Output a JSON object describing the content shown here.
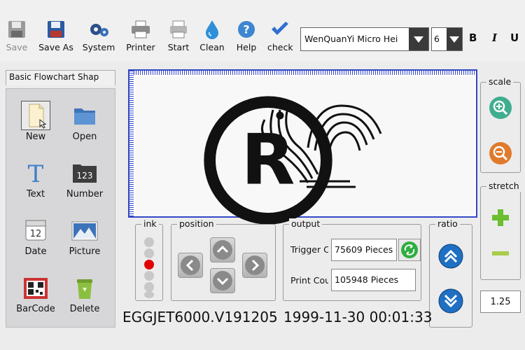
{
  "toolbar": {
    "save": "Save",
    "save_as": "Save As",
    "system": "System",
    "printer": "Printer",
    "start": "Start",
    "clean": "Clean",
    "help": "Help",
    "check": "check",
    "font_family": "WenQuanYi Micro Hei",
    "font_size": "6",
    "bold": "B",
    "italic": "I",
    "underline": "U"
  },
  "left_panel": {
    "tab": "Basic Flowchart Shap",
    "tools": [
      "New",
      "Open",
      "Text",
      "Number",
      "Date",
      "Picture",
      "BarCode",
      "Delete"
    ],
    "number_icon_text": "123",
    "date_icon_text": "12"
  },
  "groups": {
    "ink": "ink",
    "position": "position",
    "output": "output",
    "ratio": "ratio",
    "scale": "scale",
    "stretch": "stretch"
  },
  "output": {
    "trigger_label": "Trigger C",
    "trigger_value": "75609  Pieces",
    "print_label": "Print Cou",
    "print_value": "105948  Pieces"
  },
  "ratio_value": "1.25",
  "status": {
    "version": "EGGJET6000.V191205",
    "datetime": "1999-11-30 00:01:33"
  },
  "canvas": {
    "registered_mark": "R"
  },
  "ink_levels": {
    "dots": 6,
    "active_index": 2,
    "active_color": "#e00000"
  },
  "colors": {
    "canvas_border": "#3447c4",
    "ratio_arrow": "#1f6fc2",
    "zoom_in": "#3fae8f",
    "zoom_out": "#e07b2d",
    "stretch_plus": "#6cbf2e",
    "stretch_minus": "#a9cc4a"
  }
}
